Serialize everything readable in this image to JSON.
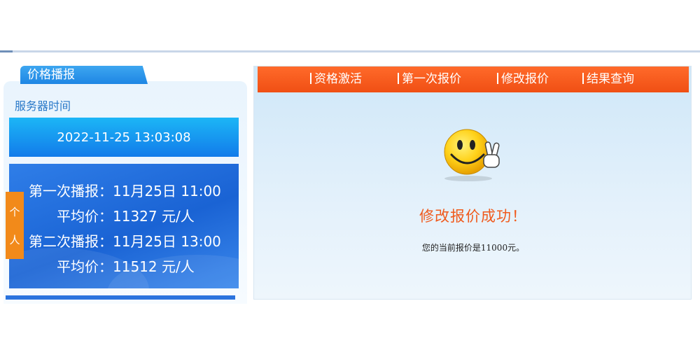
{
  "left_panel": {
    "tab_title": "价格播报",
    "server_time_label": "服务器时间",
    "server_time": "2022-11-25 13:03:08",
    "broadcasts": [
      {
        "label": "第一次播报：11月25日 11:00",
        "avg": "平均价：11327 元/人"
      },
      {
        "label": "第二次播报：11月25日 13:00",
        "avg": "平均价：11512 元/人"
      }
    ],
    "side_tab": [
      "个",
      "人"
    ]
  },
  "nav": {
    "items": [
      "资格激活",
      "第一次报价",
      "修改报价",
      "结果查询"
    ]
  },
  "result": {
    "icon": "smiley-victory-icon",
    "title": "修改报价成功！",
    "message": "您的当前报价是11000元。"
  },
  "colors": {
    "nav_bg": "#f04f14",
    "accent_blue": "#1e86e4",
    "success_text": "#f05a1c",
    "side_tab": "#f28a1a"
  }
}
